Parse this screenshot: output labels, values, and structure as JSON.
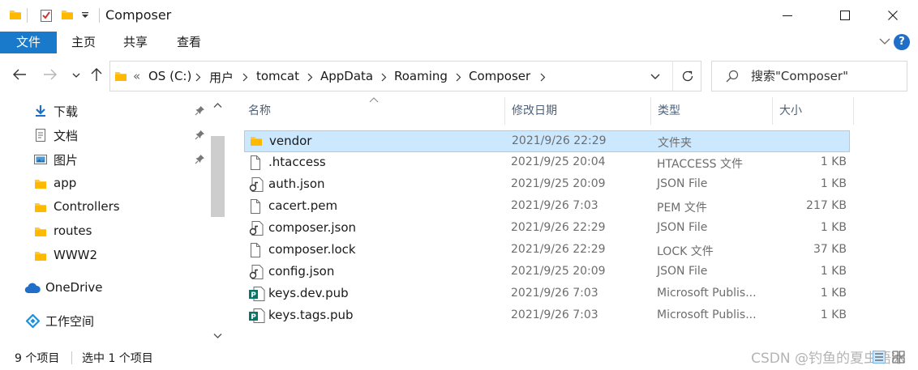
{
  "window": {
    "title": "Composer",
    "controls": {
      "minimize": "minimize-icon",
      "maximize": "maximize-icon",
      "close": "close-icon"
    }
  },
  "ribbon": {
    "tabs": [
      "文件",
      "主页",
      "共享",
      "查看"
    ],
    "help": "?"
  },
  "address": {
    "overflow": "«",
    "crumbs": [
      "OS (C:)",
      "用户",
      "tomcat",
      "AppData",
      "Roaming",
      "Composer"
    ]
  },
  "search": {
    "placeholder": "搜索\"Composer\""
  },
  "nav_pane": {
    "items": [
      {
        "label": "下载",
        "icon": "download-icon",
        "pinned": true
      },
      {
        "label": "文档",
        "icon": "document-icon",
        "pinned": true
      },
      {
        "label": "图片",
        "icon": "picture-icon",
        "pinned": true
      },
      {
        "label": "app",
        "icon": "folder-icon",
        "pinned": false
      },
      {
        "label": "Controllers",
        "icon": "folder-icon",
        "pinned": false
      },
      {
        "label": "routes",
        "icon": "folder-icon",
        "pinned": false
      },
      {
        "label": "WWW2",
        "icon": "folder-icon",
        "pinned": false
      },
      {
        "label": "OneDrive",
        "icon": "onedrive-icon",
        "pinned": false
      },
      {
        "label": "工作空间",
        "icon": "workspace-icon",
        "pinned": false
      }
    ]
  },
  "file_list": {
    "columns": [
      "名称",
      "修改日期",
      "类型",
      "大小"
    ],
    "rows": [
      {
        "name": "vendor",
        "date": "2021/9/26 22:29",
        "type": "文件夹",
        "size": "",
        "icon": "folder-icon",
        "selected": true
      },
      {
        "name": ".htaccess",
        "date": "2021/9/25 20:04",
        "type": "HTACCESS 文件",
        "size": "1 KB",
        "icon": "file-icon",
        "selected": false
      },
      {
        "name": "auth.json",
        "date": "2021/9/25 20:09",
        "type": "JSON File",
        "size": "1 KB",
        "icon": "json-file-icon",
        "selected": false
      },
      {
        "name": "cacert.pem",
        "date": "2021/9/26 7:03",
        "type": "PEM 文件",
        "size": "217 KB",
        "icon": "file-icon",
        "selected": false
      },
      {
        "name": "composer.json",
        "date": "2021/9/26 22:29",
        "type": "JSON File",
        "size": "1 KB",
        "icon": "json-file-icon",
        "selected": false
      },
      {
        "name": "composer.lock",
        "date": "2021/9/26 22:29",
        "type": "LOCK 文件",
        "size": "37 KB",
        "icon": "file-icon",
        "selected": false
      },
      {
        "name": "config.json",
        "date": "2021/9/25 20:09",
        "type": "JSON File",
        "size": "1 KB",
        "icon": "json-file-icon",
        "selected": false
      },
      {
        "name": "keys.dev.pub",
        "date": "2021/9/26 7:03",
        "type": "Microsoft Publis...",
        "size": "1 KB",
        "icon": "publisher-file-icon",
        "selected": false
      },
      {
        "name": "keys.tags.pub",
        "date": "2021/9/26 7:03",
        "type": "Microsoft Publis...",
        "size": "1 KB",
        "icon": "publisher-file-icon",
        "selected": false
      }
    ]
  },
  "status": {
    "count": "9 个项目",
    "selected": "选中 1 个项目",
    "watermark": "CSDN @钓鱼的夏虫语冰"
  },
  "colors": {
    "accent": "#1979ca",
    "selection_bg": "#cce8ff",
    "selection_border": "#99d1ff",
    "folder": "#ffc83d"
  }
}
